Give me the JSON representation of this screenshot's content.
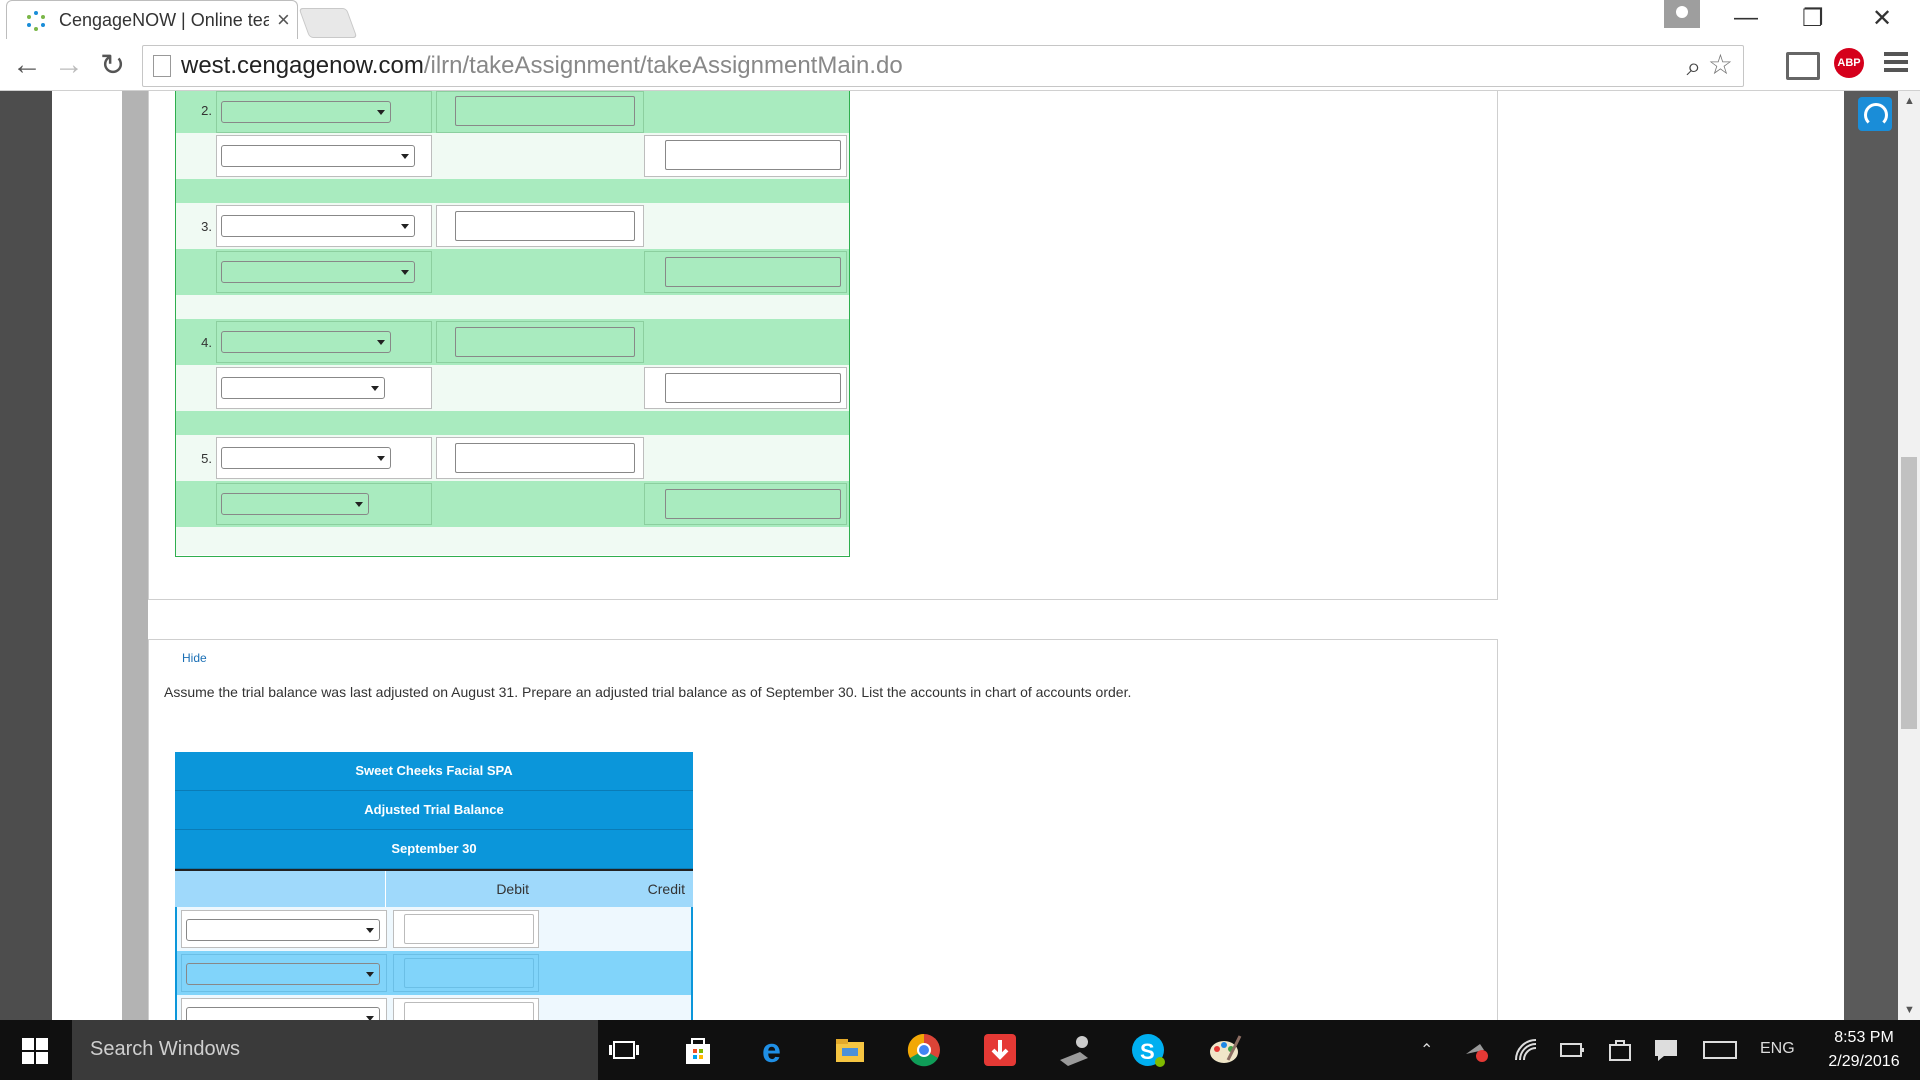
{
  "browser": {
    "tab_title": "CengageNOW | Online tea",
    "tab_close": "×",
    "url_host": "west.cengagenow.com",
    "url_path": "/ilrn/takeAssignment/takeAssignmentMain.do",
    "back": "←",
    "forward": "→",
    "reload": "↻",
    "zoom_icon": "⌕",
    "star_icon": "☆",
    "abp_label": "ABP",
    "window_controls": {
      "minimize": "—",
      "restore": "❐",
      "close": "✕"
    }
  },
  "journal": {
    "rows": [
      {
        "number": "2."
      },
      {
        "number": "3."
      },
      {
        "number": "4."
      },
      {
        "number": "5."
      }
    ]
  },
  "section2": {
    "hide_link": "Hide",
    "instructions": "Assume the trial balance was last adjusted on August 31. Prepare an adjusted trial balance as of September 30. List the accounts in chart of accounts order."
  },
  "trial_balance": {
    "company": "Sweet Cheeks Facial SPA",
    "title": "Adjusted Trial Balance",
    "date": "September 30",
    "col_debit": "Debit",
    "col_credit": "Credit"
  },
  "taskbar": {
    "search_placeholder": "Search Windows",
    "language": "ENG",
    "time": "8:53 PM",
    "date": "2/29/2016"
  },
  "colors": {
    "journal_green": "#a9ebbf",
    "journal_border": "#2fae4e",
    "tb_header_blue": "#0b96da",
    "tb_row_blue": "#81d4fa"
  }
}
